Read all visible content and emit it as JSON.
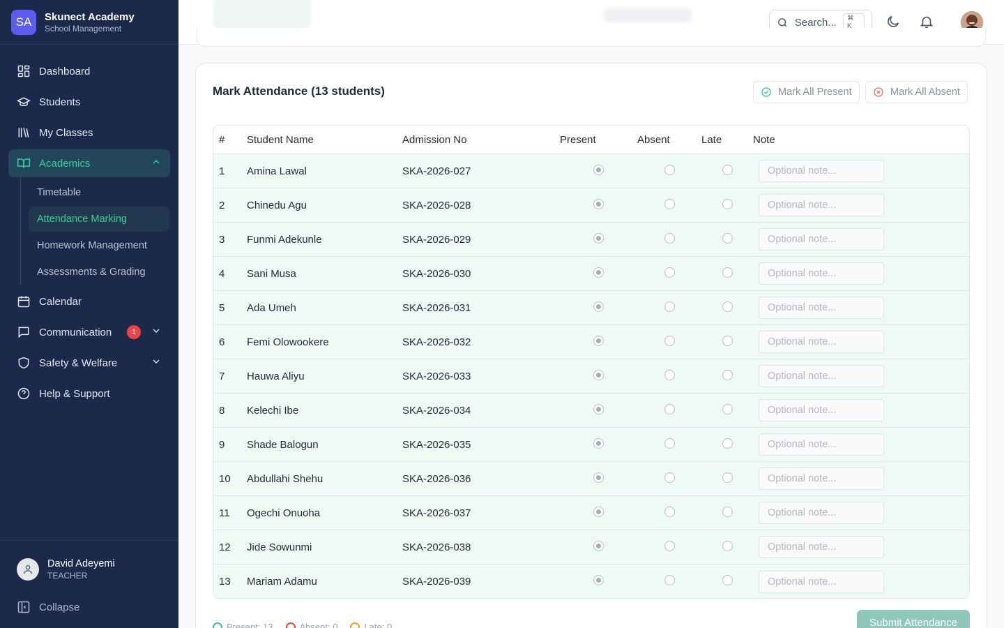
{
  "brand": {
    "initials": "SA",
    "name": "Skunect Academy",
    "subtitle": "School Management"
  },
  "nav": {
    "dashboard": "Dashboard",
    "students": "Students",
    "my_classes": "My Classes",
    "academics": "Academics",
    "academics_sub": [
      "Timetable",
      "Attendance Marking",
      "Homework Management",
      "Assessments & Grading"
    ],
    "calendar": "Calendar",
    "communication": "Communication",
    "communication_badge": "1",
    "safety": "Safety & Welfare",
    "help": "Help & Support"
  },
  "user": {
    "name": "David Adeyemi",
    "role": "TEACHER"
  },
  "collapse_label": "Collapse",
  "topbar": {
    "search_placeholder": "Search...",
    "shortcut": "⌘ K"
  },
  "card": {
    "title": "Mark Attendance (13 students)",
    "mark_all_present": "Mark All Present",
    "mark_all_absent": "Mark All Absent"
  },
  "table": {
    "headers": [
      "#",
      "Student Name",
      "Admission No",
      "Present",
      "Absent",
      "Late",
      "Note"
    ],
    "note_placeholder": "Optional note...",
    "rows": [
      {
        "num": "1",
        "name": "Amina Lawal",
        "adm": "SKA-2026-027",
        "status": "present"
      },
      {
        "num": "2",
        "name": "Chinedu Agu",
        "adm": "SKA-2026-028",
        "status": "present"
      },
      {
        "num": "3",
        "name": "Funmi Adekunle",
        "adm": "SKA-2026-029",
        "status": "present"
      },
      {
        "num": "4",
        "name": "Sani Musa",
        "adm": "SKA-2026-030",
        "status": "present"
      },
      {
        "num": "5",
        "name": "Ada Umeh",
        "adm": "SKA-2026-031",
        "status": "present"
      },
      {
        "num": "6",
        "name": "Femi Olowookere",
        "adm": "SKA-2026-032",
        "status": "present"
      },
      {
        "num": "7",
        "name": "Hauwa Aliyu",
        "adm": "SKA-2026-033",
        "status": "present"
      },
      {
        "num": "8",
        "name": "Kelechi Ibe",
        "adm": "SKA-2026-034",
        "status": "present"
      },
      {
        "num": "9",
        "name": "Shade Balogun",
        "adm": "SKA-2026-035",
        "status": "present"
      },
      {
        "num": "10",
        "name": "Abdullahi Shehu",
        "adm": "SKA-2026-036",
        "status": "present"
      },
      {
        "num": "11",
        "name": "Ogechi Onuoha",
        "adm": "SKA-2026-037",
        "status": "present"
      },
      {
        "num": "12",
        "name": "Jide Sowunmi",
        "adm": "SKA-2026-038",
        "status": "present"
      },
      {
        "num": "13",
        "name": "Mariam Adamu",
        "adm": "SKA-2026-039",
        "status": "present"
      }
    ]
  },
  "summary": {
    "present": "Present: 13",
    "absent": "Absent: 0",
    "late": "Late: 0"
  },
  "submit_label": "Submit Attendance",
  "colors": {
    "sidebar": "#1b2a4a",
    "accent": "#34d399",
    "row_bg": "#eefbf4",
    "submit": "#8fc7b8"
  }
}
